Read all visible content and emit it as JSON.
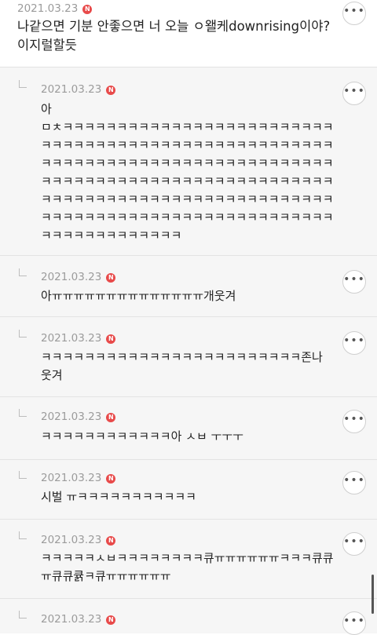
{
  "badge_label": "N",
  "more_glyph": "•••",
  "top_comment": {
    "date": "2021.03.23",
    "text": "나같으면 기분 안좋으면 너 오늘 ㅇ왤케downrising이야? 이지럴할듯"
  },
  "replies": [
    {
      "date": "2021.03.23",
      "text": "아\nㅁㅊㅋㅋㅋㅋㅋㅋㅋㅋㅋㅋㅋㅋㅋㅋㅋㅋㅋㅋㅋㅋㅋㅋㅋㅋㅋ\nㅋㅋㅋㅋㅋㅋㅋㅋㅋㅋㅋㅋㅋㅋㅋㅋㅋㅋㅋㅋㅋㅋㅋㅋㅋㅋㅋ\nㅋㅋㅋㅋㅋㅋㅋㅋㅋㅋㅋㅋㅋㅋㅋㅋㅋㅋㅋㅋㅋㅋㅋㅋㅋㅋㅋ\nㅋㅋㅋㅋㅋㅋㅋㅋㅋㅋㅋㅋㅋㅋㅋㅋㅋㅋㅋㅋㅋㅋㅋㅋㅋㅋㅋ\nㅋㅋㅋㅋㅋㅋㅋㅋㅋㅋㅋㅋㅋㅋㅋㅋㅋㅋㅋㅋㅋㅋㅋㅋㅋㅋㅋ\nㅋㅋㅋㅋㅋㅋㅋㅋㅋㅋㅋㅋㅋㅋㅋㅋㅋㅋㅋㅋㅋㅋㅋㅋㅋㅋㅋ\nㅋㅋㅋㅋㅋㅋㅋㅋㅋㅋㅋㅋㅋ"
    },
    {
      "date": "2021.03.23",
      "text": "아ㅠㅠㅠㅠㅠㅠㅠㅠㅠㅠㅠㅠㅠㅠ개웃겨"
    },
    {
      "date": "2021.03.23",
      "text": "ㅋㅋㅋㅋㅋㅋㅋㅋㅋㅋㅋㅋㅋㅋㅋㅋㅋㅋㅋㅋㅋㅋㅋㅋ존나\n웃겨"
    },
    {
      "date": "2021.03.23",
      "text": "ㅋㅋㅋㅋㅋㅋㅋㅋㅋㅋㅋㅋ아 ㅅㅂ ㅜㅜㅜ"
    },
    {
      "date": "2021.03.23",
      "text": "시벌 ㅠㅋㅋㅋㅋㅋㅋㅋㅋㅋㅋㅋ"
    },
    {
      "date": "2021.03.23",
      "text": "ㅋㅋㅋㅋㅋㅅㅂㅋㅋㅋㅋㅋㅋㅋㅋ큐ㅠㅠㅠㅠㅠㅠㅋㅋㅋ큐큐\nㅠ큐큐큙ㅋ큐ㅠㅠㅠㅠㅠㅠ"
    },
    {
      "date": "2021.03.23",
      "text": ""
    }
  ]
}
